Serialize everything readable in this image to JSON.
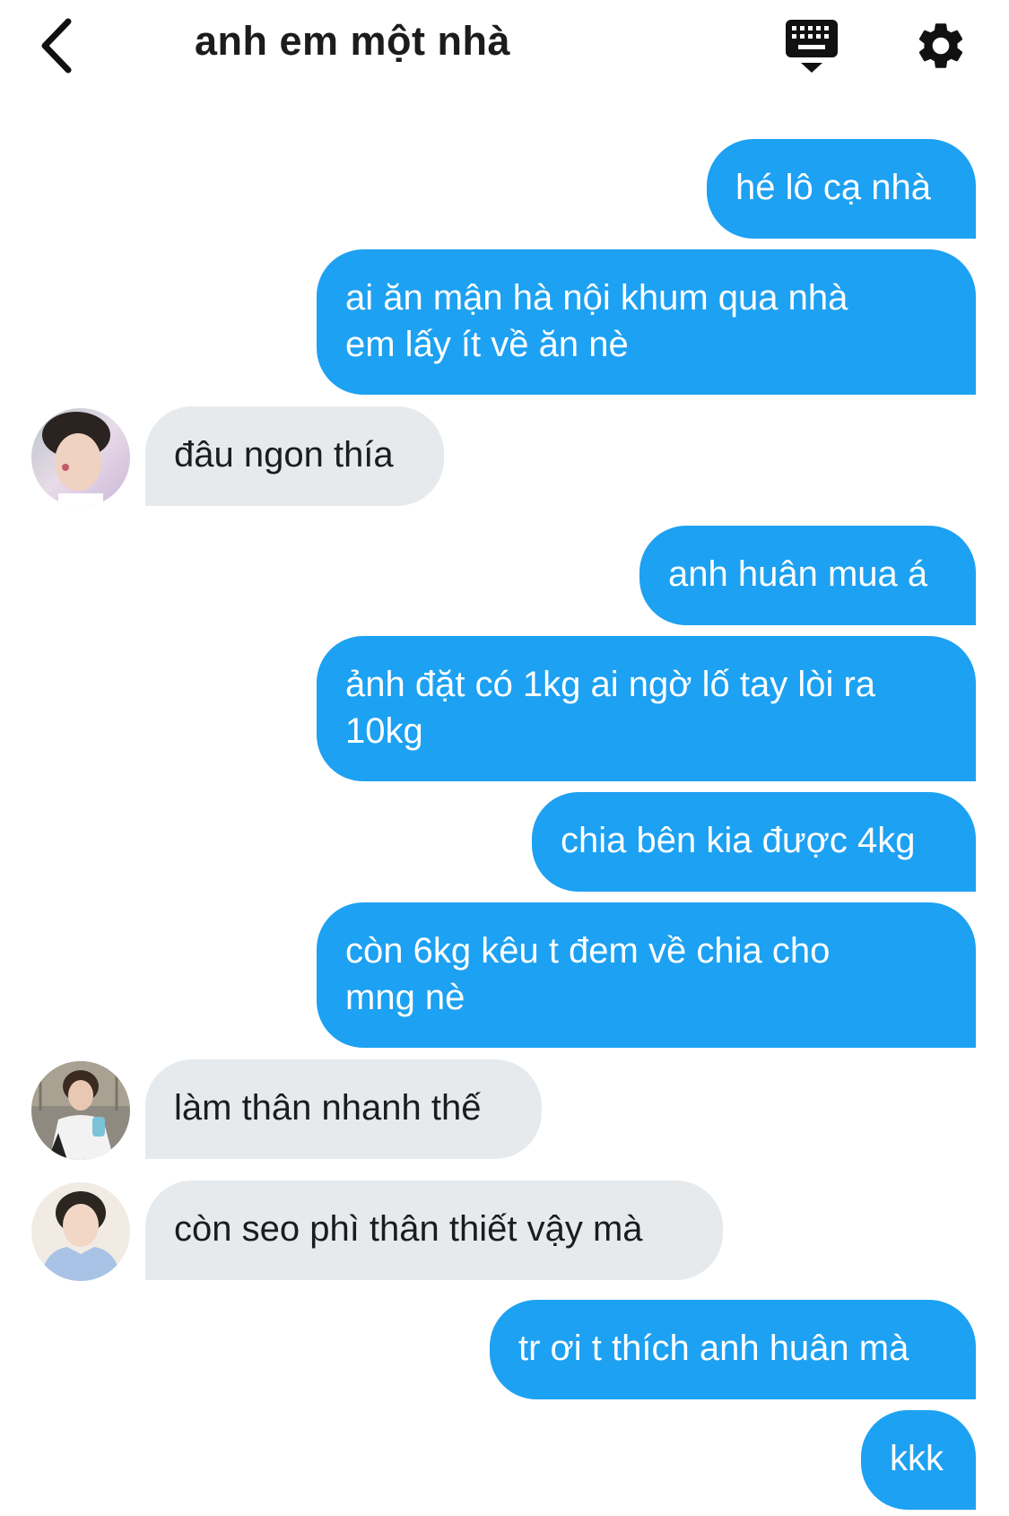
{
  "header": {
    "title": "anh em một nhà",
    "back_icon": "chevron-left-icon",
    "keyboard_icon": "keyboard-icon",
    "settings_icon": "gear-icon"
  },
  "colors": {
    "outgoing_bubble": "#1da1f2",
    "incoming_bubble": "#e7eaed",
    "text_dark": "#1c1c1c"
  },
  "messages": [
    {
      "direction": "out",
      "lines": [
        "hé lô cạ nhà"
      ]
    },
    {
      "direction": "out",
      "lines": [
        "ai ăn mận hà nội khum qua nhà",
        "em lấy ít về ăn nè"
      ]
    },
    {
      "direction": "in",
      "lines": [
        "đâu ngon thía"
      ]
    },
    {
      "direction": "out",
      "lines": [
        "anh huân mua á"
      ]
    },
    {
      "direction": "out",
      "lines": [
        "ảnh đặt có 1kg ai ngờ lố tay lòi ra",
        "10kg"
      ]
    },
    {
      "direction": "out",
      "lines": [
        "chia bên kia được 4kg"
      ]
    },
    {
      "direction": "out",
      "lines": [
        "còn 6kg kêu t đem về chia cho",
        "mng nè"
      ]
    },
    {
      "direction": "in",
      "lines": [
        "làm thân nhanh thế"
      ]
    },
    {
      "direction": "in",
      "lines": [
        "còn seo phì thân thiết vậy mà"
      ]
    },
    {
      "direction": "out",
      "lines": [
        "tr ơi t thích anh huân mà"
      ]
    },
    {
      "direction": "out",
      "lines": [
        "kkk"
      ]
    }
  ]
}
